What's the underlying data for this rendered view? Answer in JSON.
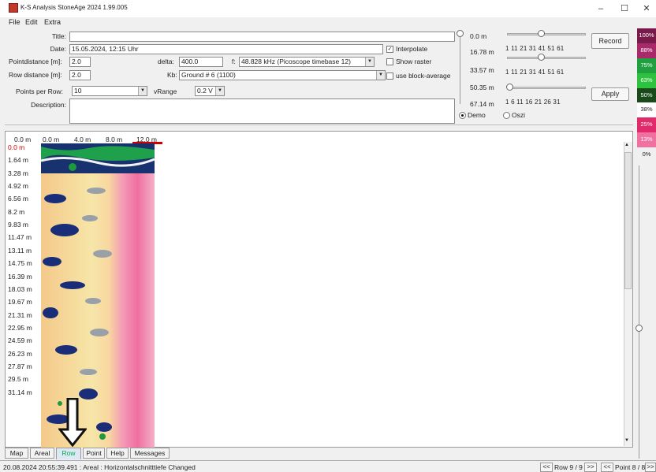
{
  "window": {
    "title": "K-S Analysis StoneAge 2024 1.99.005",
    "minimize": "–",
    "maximize": "☐",
    "close": "✕"
  },
  "menu": [
    "File",
    "Edit",
    "Extra"
  ],
  "form": {
    "title_label": "Title:",
    "title_value": "",
    "date_label": "Date:",
    "date_value": "15.05.2024, 12:15 Uhr",
    "pointdistance_label": "Pointdistance [m]:",
    "pointdistance_value": "2.0",
    "delta_label": "delta:",
    "delta_value": "400.0",
    "f_label": "f:",
    "f_value": "48.828 kHz (Picoscope timebase 12)",
    "rowdistance_label": "Row distance [m]:",
    "rowdistance_value": "2.0",
    "kb_label": "Kb:",
    "kb_value": "Ground # 6 (1100)",
    "ppr_label": "Points per Row:",
    "ppr_value": "10",
    "vrange_label": "vRange",
    "vrange_value": "0.2 V",
    "description_label": "Description:",
    "description_value": ""
  },
  "checks": {
    "interpolate": "Interpolate",
    "interpolate_on": true,
    "raster": "Show raster",
    "raster_on": false,
    "block": "use block-average",
    "block_on": false
  },
  "mode": {
    "demo": "Demo",
    "oszi": "Oszi",
    "selected": "demo"
  },
  "depth": {
    "labels": [
      "0.0 m",
      "16.78 m",
      "33.57 m",
      "50.35 m",
      "67.14 m"
    ]
  },
  "sliders": {
    "row_ticks": "1   11  21  31  41  51  61",
    "point_ticks": "1   6   11  16  21  26  31",
    "row_value": 0.43,
    "row2_value": 0.43,
    "point_value": 0.03
  },
  "buttons": {
    "record": "Record",
    "apply": "Apply"
  },
  "colorbar": {
    "items": [
      {
        "label": "100%",
        "color": "#7a1a4a"
      },
      {
        "label": "88%",
        "color": "#a82a6a"
      },
      {
        "label": "75%",
        "color": "#20a040"
      },
      {
        "label": "63%",
        "color": "#2ec23e"
      },
      {
        "label": "50%",
        "color": "#1a4a1a"
      },
      {
        "label": "38%",
        "color": "#ffffff"
      },
      {
        "label": "25%",
        "color": "#e02a6a"
      },
      {
        "label": "13%",
        "color": "#f070a0"
      },
      {
        "label": "0%",
        "color": "#f0f0f0"
      }
    ]
  },
  "viewer": {
    "x_axis": {
      "labels": [
        "0.0 m",
        "0.0 m",
        "4.0 m",
        "8.0 m",
        "12.0 m"
      ]
    },
    "y_axis": {
      "labels": [
        "0.0 m",
        "1.64 m",
        "3.28 m",
        "4.92 m",
        "6.56 m",
        "8.2 m",
        "9.83 m",
        "11.47 m",
        "13.11 m",
        "14.75 m",
        "16.39 m",
        "18.03 m",
        "19.67 m",
        "21.31 m",
        "22.95 m",
        "24.59 m",
        "26.23 m",
        "27.87 m",
        "29.5 m",
        "31.14 m"
      ]
    }
  },
  "tabs": {
    "items": [
      "Map",
      "Areal",
      "Row",
      "Point",
      "Help",
      "Messages"
    ],
    "selected": "Row"
  },
  "status": {
    "text": "20.08.2024 20:55:39.491 : Areal :   Horizontalschnitttiefe Changed",
    "row_prev": "<<",
    "row_label": "Row 9 / 9",
    "row_next": ">>",
    "point_prev": "<<",
    "point_label": "Point 8 / 8",
    "point_next": ">>"
  },
  "colors": {
    "accent": "#2e6bc4",
    "marker": "#d10000"
  }
}
